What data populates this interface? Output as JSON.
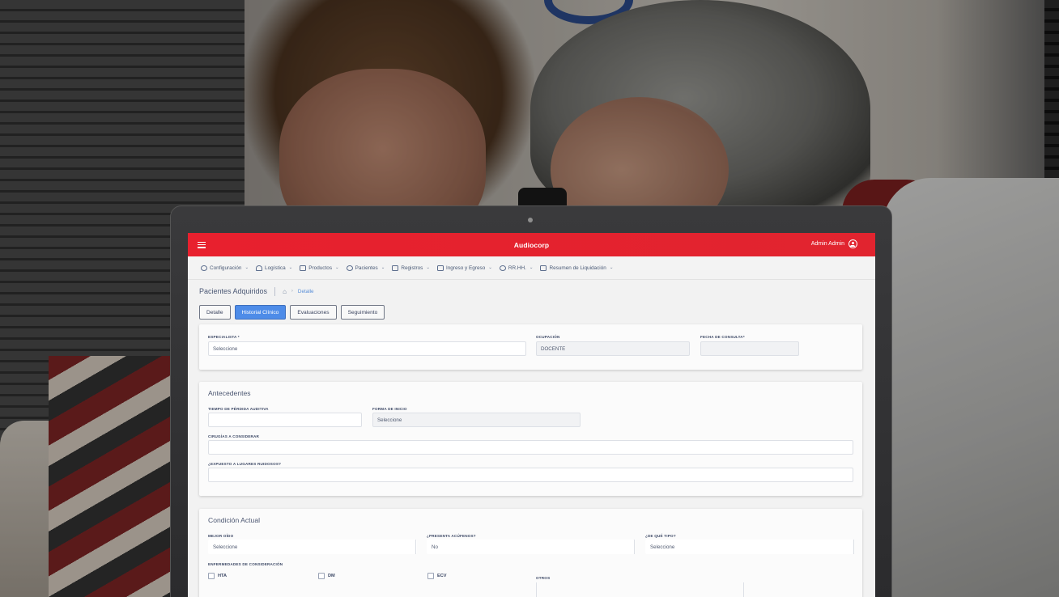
{
  "app": {
    "title": "Audiocorp",
    "user_name": "Admin Admin",
    "brand_color": "#e8202e",
    "accent_color": "#4e8ce8"
  },
  "navbar": {
    "items": [
      {
        "label": "Configuración",
        "icon": "gears-icon"
      },
      {
        "label": "Logística",
        "icon": "truck-icon"
      },
      {
        "label": "Productos",
        "icon": "gift-icon"
      },
      {
        "label": "Pacientes",
        "icon": "user-icon"
      },
      {
        "label": "Registros",
        "icon": "camera-icon"
      },
      {
        "label": "Ingreso y Egreso",
        "icon": "wallet-icon"
      },
      {
        "label": "RR.HH.",
        "icon": "person-icon"
      },
      {
        "label": "Resumen de Liquidación",
        "icon": "calendar-icon"
      }
    ]
  },
  "breadcrumb": {
    "page_title": "Pacientes Adquiridos",
    "current": "Detalle"
  },
  "tabs": [
    {
      "label": "Detalle",
      "active": false
    },
    {
      "label": "Historial Clínico",
      "active": true
    },
    {
      "label": "Evaluaciones",
      "active": false
    },
    {
      "label": "Seguimiento",
      "active": false
    }
  ],
  "card1": {
    "especialista_label": "ESPECIALISTA *",
    "especialista_value": "Seleccione",
    "ocupacion_label": "OCUPACIÓN",
    "ocupacion_value": "DOCENTE",
    "fecha_label": "FECHA DE CONSULTA*",
    "fecha_value": ""
  },
  "antecedentes": {
    "title": "Antecedentes",
    "tiempo_label": "TIEMPO DE PÉRDIDA AUDITIVA",
    "tiempo_value": "",
    "forma_label": "FORMA DE INICIO",
    "forma_value": "Seleccione",
    "cirugias_label": "CIRUGÍAS A CONSIDERAR",
    "cirugias_value": "",
    "expuesto_label": "¿EXPUESTO A LUGARES RUIDOSOS?",
    "expuesto_value": ""
  },
  "condicion": {
    "title": "Condición Actual",
    "mejor_oido_label": "MEJOR OÍDO",
    "mejor_oido_value": "Seleccione",
    "acufenos_label": "¿PRESENTA ACÚFENOS?",
    "acufenos_value": "No",
    "tipo_label": "¿DE QUÉ TIPO?",
    "tipo_value": "Seleccione",
    "enfermedades_label": "ENFERMEDADES DE CONSIDERACIÓN",
    "checks": [
      "HTA",
      "DM",
      "ECV"
    ],
    "otros_label": "OTROS"
  }
}
